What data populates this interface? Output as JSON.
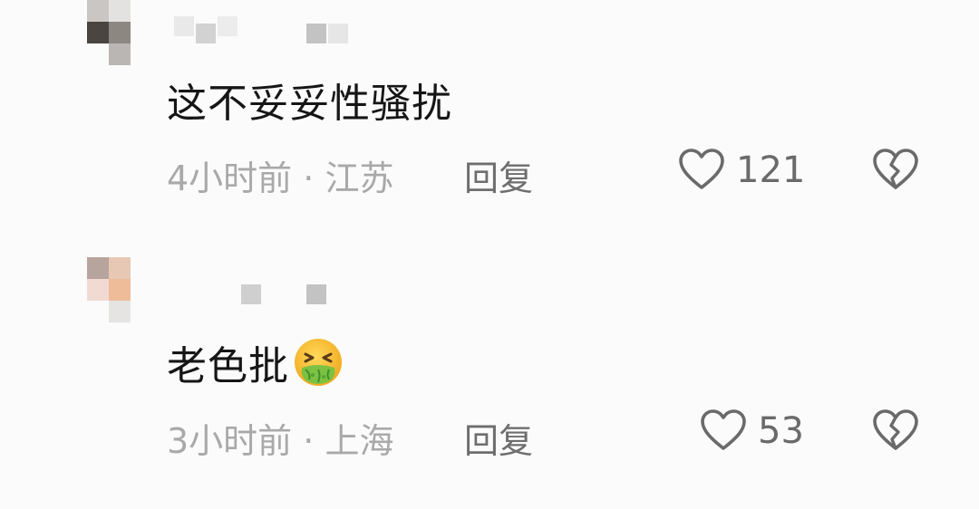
{
  "comments": [
    {
      "text": "这不妥妥性骚扰",
      "time": "4小时前",
      "separator": "·",
      "location": "江苏",
      "reply_label": "回复",
      "likes": "121",
      "icons": {
        "like": "heart-outline-icon",
        "dislike": "broken-heart-icon"
      }
    },
    {
      "text": "老色批",
      "emoji": "nauseated-face-emoji",
      "time": "3小时前",
      "separator": "·",
      "location": "上海",
      "reply_label": "回复",
      "likes": "53",
      "icons": {
        "like": "heart-outline-icon",
        "dislike": "broken-heart-icon"
      }
    }
  ],
  "colors": {
    "background": "#fbfbfb",
    "comment_text": "#161616",
    "meta_text": "#a9a9a9",
    "reply_text": "#6e6e6e",
    "icon_stroke": "#6a6a6a"
  }
}
